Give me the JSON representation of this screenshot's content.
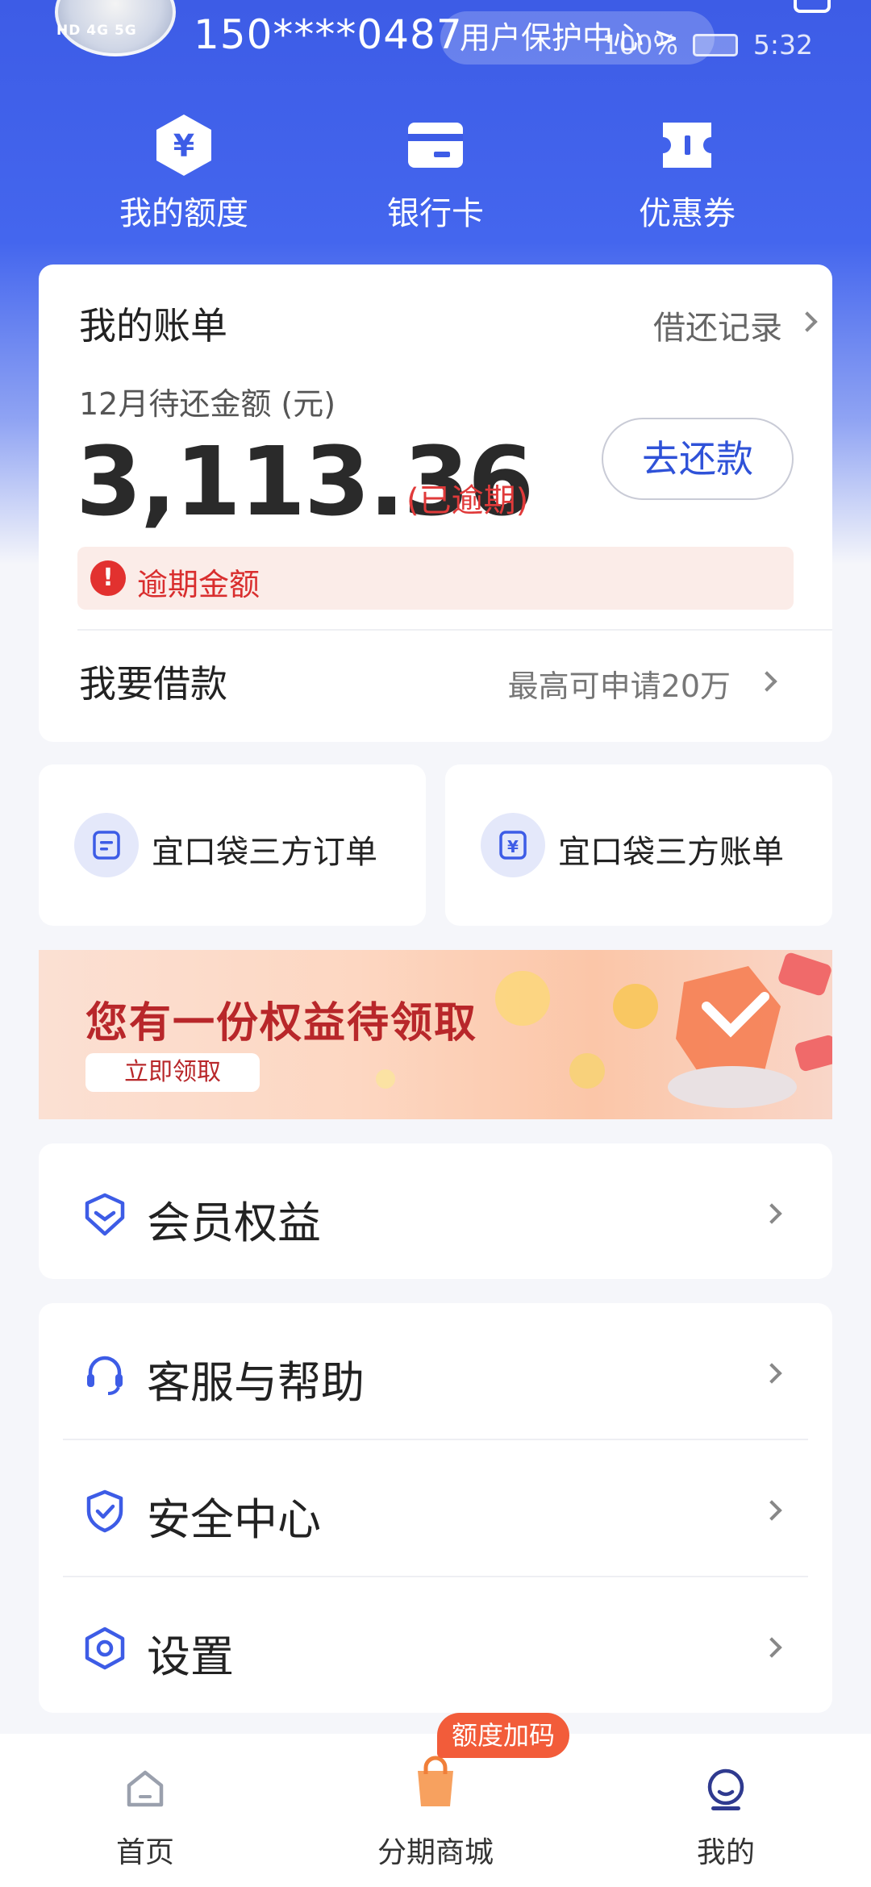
{
  "status_bar": {
    "signal_text": "HD 4G 5G",
    "battery": "100%",
    "time": "5:32"
  },
  "header": {
    "phone": "150****0487",
    "protection_center": "用户保护中心 >"
  },
  "quick_actions": [
    {
      "label": "我的额度",
      "icon": "yuan-hexagon-icon"
    },
    {
      "label": "银行卡",
      "icon": "bank-card-icon"
    },
    {
      "label": "优惠券",
      "icon": "coupon-ticket-icon"
    }
  ],
  "bill": {
    "title": "我的账单",
    "record_link": "借还记录",
    "due_label": "12月待还金额 (元)",
    "amount": "3,113.36",
    "overdue_tag": "(已逾期)",
    "repay_button": "去还款",
    "overdue_notice": "逾期金额",
    "borrow_title": "我要借款",
    "borrow_hint": "最高可申请20万"
  },
  "third_party": [
    {
      "label": "宜口袋三方订单",
      "icon": "order-doc-icon"
    },
    {
      "label": "宜口袋三方账单",
      "icon": "yuan-bill-icon"
    }
  ],
  "banner": {
    "title": "您有一份权益待领取",
    "button": "立即领取"
  },
  "menu": {
    "member": "会员权益",
    "service": "客服与帮助",
    "security": "安全中心",
    "settings": "设置"
  },
  "tab_bar": {
    "home": "首页",
    "mall": "分期商城",
    "mine": "我的",
    "mall_badge": "额度加码"
  },
  "colors": {
    "primary": "#3d5ce6",
    "danger": "#e2312f",
    "accent_link": "#2f52d8"
  }
}
